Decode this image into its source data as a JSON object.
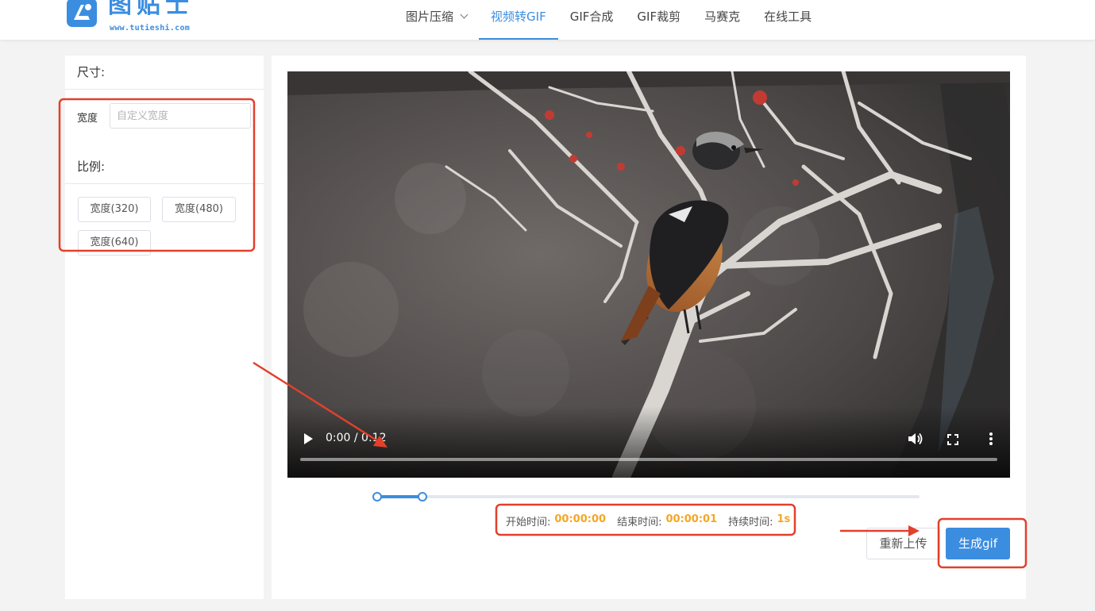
{
  "logo": {
    "name": "图贴士",
    "url": "www.tutieshi.com"
  },
  "nav": {
    "items": [
      {
        "label": "图片压缩",
        "has_dropdown": true
      },
      {
        "label": "视频转GIF",
        "active": true
      },
      {
        "label": "GIF合成"
      },
      {
        "label": "GIF裁剪"
      },
      {
        "label": "马赛克"
      },
      {
        "label": "在线工具"
      }
    ]
  },
  "sidebar": {
    "size_title": "尺寸:",
    "width_label": "宽度",
    "width_value": "",
    "width_placeholder": "自定义宽度",
    "ratio_title": "比例:",
    "ratio_buttons": [
      "宽度(320)",
      "宽度(480)",
      "宽度(640)"
    ]
  },
  "video": {
    "time_display": "0:00 / 0:12",
    "progress": 0
  },
  "range": {
    "start_fraction": 0.0,
    "end_fraction": 0.083
  },
  "time_info": {
    "start_label": "开始时间:",
    "start_value": "00:00:00",
    "end_label": "结束时间:",
    "end_value": "00:00:01",
    "duration_label": "持续时间:",
    "duration_value": "1s"
  },
  "actions": {
    "reupload_label": "重新上传",
    "generate_label": "生成gif"
  },
  "colors": {
    "accent": "#3b8de0",
    "highlight_value": "#f5a623",
    "annotation": "#e2402b"
  },
  "icons": [
    "play-icon",
    "volume-icon",
    "fullscreen-icon",
    "more-vert-icon",
    "chevron-down-icon"
  ]
}
